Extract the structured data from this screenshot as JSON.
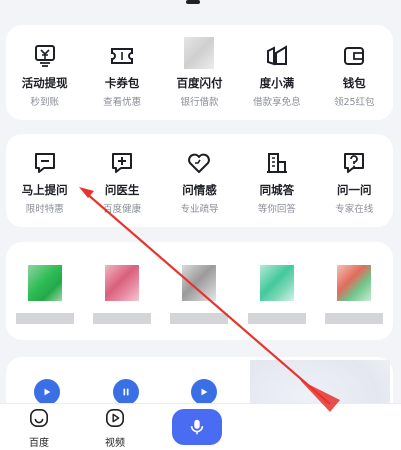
{
  "row1": [
    {
      "title": "活动提现",
      "sub": "秒到账",
      "icon": "yen-card-icon"
    },
    {
      "title": "卡券包",
      "sub": "查看优惠",
      "icon": "ticket-icon"
    },
    {
      "title": "百度闪付",
      "sub": "银行借款",
      "icon": "blurred-icon"
    },
    {
      "title": "度小满",
      "sub": "借款享免息",
      "icon": "dxm-logo-icon"
    },
    {
      "title": "钱包",
      "sub": "领25红包",
      "icon": "wallet-icon"
    }
  ],
  "row2": [
    {
      "title": "马上提问",
      "sub": "限时特惠",
      "icon": "question-bubble-icon"
    },
    {
      "title": "问医生",
      "sub": "百度健康",
      "icon": "medical-cross-icon"
    },
    {
      "title": "问情感",
      "sub": "专业疏导",
      "icon": "heart-icon"
    },
    {
      "title": "同城答",
      "sub": "等你回答",
      "icon": "building-icon"
    },
    {
      "title": "问一问",
      "sub": "专家在线",
      "icon": "question-mark-icon"
    }
  ],
  "tabs": {
    "home": "百度",
    "video": "视频"
  },
  "colors": {
    "accent": "#4a6cf2",
    "annotation": "#e8332d"
  }
}
